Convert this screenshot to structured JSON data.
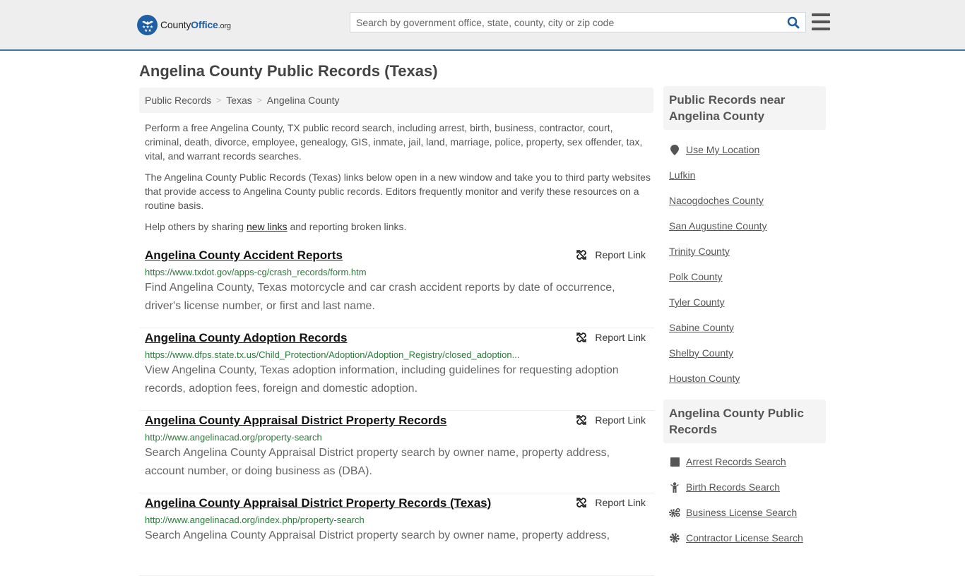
{
  "header": {
    "logo": {
      "brand_main": "County",
      "brand_accent": "Office",
      "brand_tld": ".org",
      "icon": "eagle-stars-badge-icon"
    },
    "search": {
      "placeholder": "Search by government office, state, county, city or zip code",
      "value": "",
      "icon": "search-icon"
    },
    "menu_icon": "hamburger-menu-icon",
    "colors": {
      "accent": "#1f5fa3",
      "border": "#3c78a8",
      "background": "#eeeeee"
    }
  },
  "page": {
    "title": "Angelina County Public Records (Texas)",
    "breadcrumb": [
      {
        "label": "Public Records"
      },
      {
        "label": "Texas"
      },
      {
        "label": "Angelina County"
      }
    ],
    "breadcrumb_separator": ">",
    "intro": {
      "p1": "Perform a free Angelina County, TX public record search, including arrest, birth, business, contractor, court, criminal, death, divorce, employee, genealogy, GIS, inmate, jail, land, marriage, police, property, sex offender, tax, vital, and warrant records searches.",
      "p2": "The Angelina County Public Records (Texas) links below open in a new window and take you to third party websites that provide access to Angelina County public records. Editors frequently monitor and verify these resources on a routine basis.",
      "p3_before": "Help others by sharing ",
      "p3_link": "new links",
      "p3_after": " and reporting broken links."
    }
  },
  "results": [
    {
      "title": "Angelina County Accident Reports",
      "url": "https://www.txdot.gov/apps-cg/crash_records/form.htm",
      "description": "Find Angelina County, Texas motorcycle and car crash accident reports by date of occurrence, driver's license number, or first and last name.",
      "report_label": "Report Link"
    },
    {
      "title": "Angelina County Adoption Records",
      "url": "https://www.dfps.state.tx.us/Child_Protection/Adoption/Adoption_Registry/closed_adoption...",
      "description": "View Angelina County, Texas adoption information, including guidelines for requesting adoption records, adoption fees, foreign and domestic adoption.",
      "report_label": "Report Link"
    },
    {
      "title": "Angelina County Appraisal District Property Records",
      "url": "http://www.angelinacad.org/property-search",
      "description": "Search Angelina County Appraisal District property search by owner name, property address, account number, or doing business as (DBA).",
      "report_label": "Report Link"
    },
    {
      "title": "Angelina County Appraisal District Property Records (Texas)",
      "url": "http://www.angelinacad.org/index.php/property-search",
      "description": "Search Angelina County Appraisal District property search by owner name, property address,",
      "report_label": "Report Link"
    }
  ],
  "sidebar": {
    "nearby": {
      "heading": "Public Records near Angelina County",
      "use_location": {
        "label": "Use My Location",
        "icon": "map-marker-icon"
      },
      "items": [
        {
          "label": "Lufkin"
        },
        {
          "label": "Nacogdoches County"
        },
        {
          "label": "San Augustine County"
        },
        {
          "label": "Trinity County"
        },
        {
          "label": "Polk County"
        },
        {
          "label": "Tyler County"
        },
        {
          "label": "Sabine County"
        },
        {
          "label": "Shelby County"
        },
        {
          "label": "Houston County"
        }
      ]
    },
    "records": {
      "heading": "Angelina County Public Records",
      "items": [
        {
          "label": "Arrest Records Search",
          "icon": "square-icon"
        },
        {
          "label": "Birth Records Search",
          "icon": "child-icon"
        },
        {
          "label": "Business License Search",
          "icon": "gears-icon"
        },
        {
          "label": "Contractor License Search",
          "icon": "gear-icon"
        }
      ]
    }
  }
}
